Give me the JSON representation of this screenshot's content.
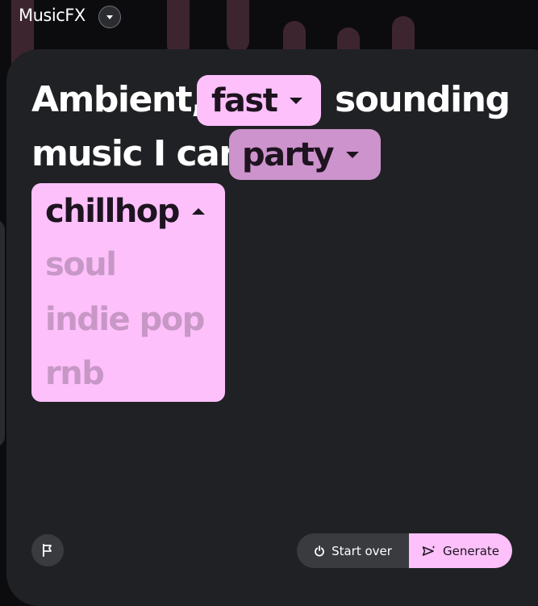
{
  "app": {
    "title": "MusicFX"
  },
  "prompt": {
    "word1": "Ambient,",
    "word2": "sounding",
    "word3": "music I can",
    "chip1": {
      "label": "fast"
    },
    "chip2": {
      "label": "party"
    },
    "dropdown": {
      "selected": "chillhop",
      "options": [
        "soul",
        "indie pop",
        "rnb"
      ]
    }
  },
  "actions": {
    "start_over": "Start over",
    "generate": "Generate"
  },
  "icons": {
    "title_caret": "chevron-down-icon",
    "flag": "flag-icon",
    "start_over": "power-icon",
    "generate": "send-sparkle-icon"
  },
  "colors": {
    "accent": "#fdc0fb",
    "chip_active": "#cd93cc",
    "card": "#202124",
    "option_text": "#c797c6"
  }
}
